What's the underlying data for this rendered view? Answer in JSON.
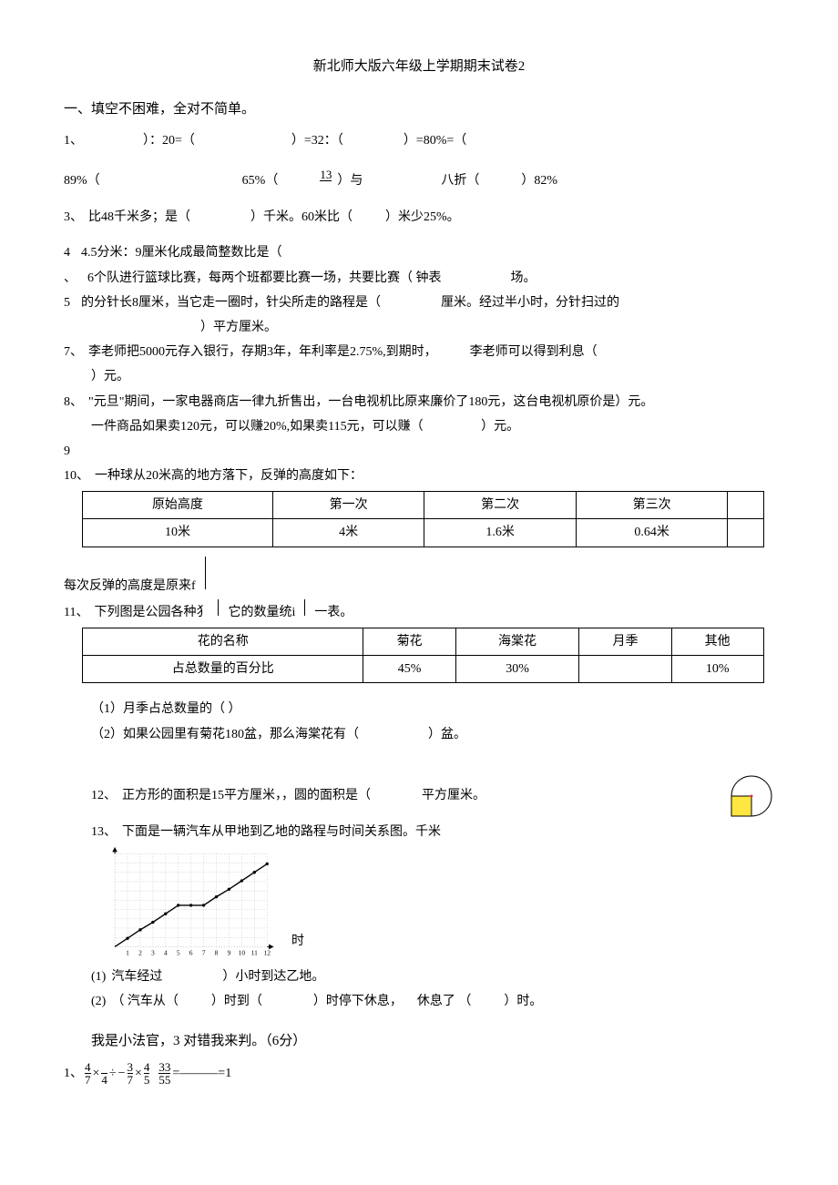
{
  "title": "新北师大版六年级上学期期末试卷2",
  "section1_head": "一、填空不困难，全对不简单。",
  "q1_label": "1、",
  "q1_a": "）：20=（",
  "q1_b": "）=32：（",
  "q1_c": "）=80%=（",
  "q2_a": "89%（",
  "q2_b": "65%（",
  "q2_c": "）与",
  "q2_frac_n": "13",
  "q2_d": "八折（",
  "q2_e": "）82%",
  "q3_label": "3、",
  "q3_text_a": "比48千米多；是（",
  "q3_text_b": "）千米。60米比（",
  "q3_text_c": "）米少25%。",
  "q4_label": "4",
  "q4_text": "4.5分米：9厘米化成最简整数比是（",
  "q4b_label": "、",
  "q4b_text": "6个队进行篮球比赛，每两个班都要比赛一场，共要比赛（  钟表",
  "q4b_tail": "场。",
  "q5_label": "5",
  "q5_text_a": "的分针长8厘米，当它走一圈时，针尖所走的路程是（",
  "q5_text_b": "厘米。经过半小时，分针扫过的",
  "q5_text_c": "）平方厘米。",
  "q7_label": "7、",
  "q7_text_a": "李老师把5000元存入银行，存期3年，年利率是2.75%,到期时，",
  "q7_text_b": "李老师可以得到利息（",
  "q7_text_c": "）元。",
  "q8_label": "8、",
  "q8_text": "\"元旦\"期间，一家电器商店一律九折售出，一台电视机比原来廉价了180元，这台电视机原价是）元。",
  "q8b_text": "一件商品如果卖120元，可以赚20%,如果卖115元，可以赚（",
  "q8b_tail": "）元。",
  "q9_label": "9",
  "q10_label": "10、",
  "q10_text": "一种球从20米高的地方落下，反弹的高度如下：",
  "table1_head": [
    "原始高度",
    "第一次",
    "第二次",
    "第三次",
    ""
  ],
  "table1_row": [
    "10米",
    "4米",
    "1.6米",
    "0.64米",
    ""
  ],
  "q10b_text": "每次反弹的高度是原来f",
  "q11_label": "11、",
  "q11_text_a": "下列图是公园各种犭",
  "q11_text_b": "它的数量统i",
  "q11_text_c": "一表。",
  "table2_head": [
    "花的名称",
    "菊花",
    "海棠花",
    "月季",
    "其他"
  ],
  "table2_row": [
    "占总数量的百分比",
    "45%",
    "30%",
    "",
    "10%"
  ],
  "q11_1": "（1）月季占总数量的（           ）",
  "q11_2a": "（2）如果公园里有菊花180盆，那么海棠花有（",
  "q11_2b": "）盆。",
  "q12_label": "12、",
  "q12_text_a": "正方形的面积是15平方厘米，，圆的面积是（",
  "q12_text_b": "平方厘米。",
  "q13_label": "13、",
  "q13_text": "下面是一辆汽车从甲地到乙地的路程与时间关系图。千米",
  "q13_x": "时",
  "q13_1a": "汽车经过",
  "q13_1b": "）小时到达乙地。",
  "q13_2a": "（ 汽车从（",
  "q13_2b": "）时到（",
  "q13_2c": "）时停下休息，",
  "q13_2d": "休息了 （",
  "q13_2e": "）时。",
  "section2_head": "我是小法官，3 对错我来判。（6分）",
  "j1_label": "1、",
  "j1_mid": "÷",
  "j1_eq": "=———=1",
  "nums": {
    "n4": "4",
    "n7": "7",
    "n3": "3",
    "n33": "33",
    "n5": "5",
    "n55": "55"
  },
  "p1": "(1)",
  "p2": "(2)",
  "chart_data": {
    "type": "line",
    "x": [
      1,
      2,
      3,
      4,
      5,
      6,
      7,
      8,
      9,
      10,
      11,
      12
    ],
    "y": [
      8,
      16,
      24,
      32,
      40,
      40,
      40,
      48,
      56,
      64,
      72,
      80
    ],
    "xlabel": "时",
    "ylabel": "千米",
    "ylim": [
      0,
      90
    ],
    "xlim": [
      0,
      12
    ],
    "title": ""
  }
}
